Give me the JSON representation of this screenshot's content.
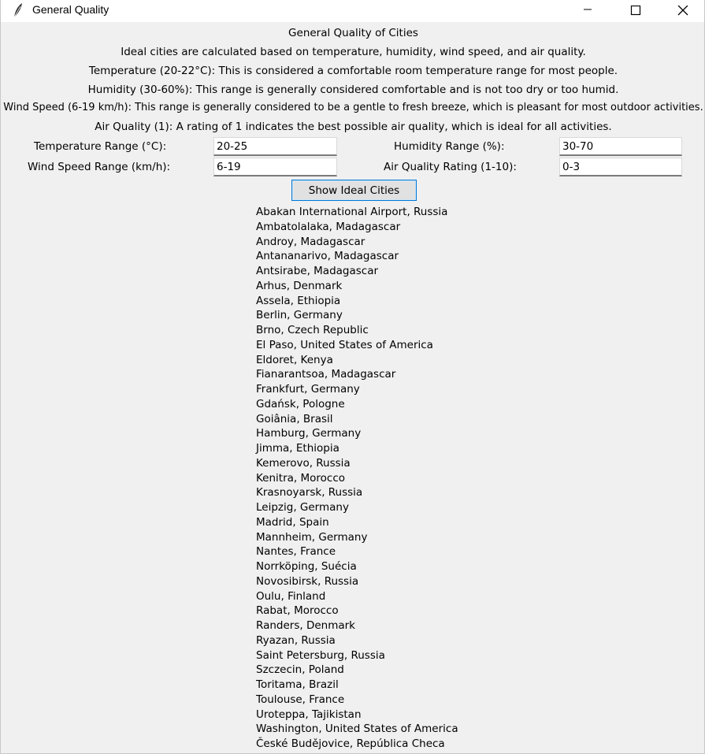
{
  "window": {
    "title": "General Quality",
    "icon": "feather-icon",
    "buttons": [
      "minimize-icon",
      "maximize-icon",
      "close-icon"
    ]
  },
  "header": {
    "heading": "General Quality of Cities",
    "lines": [
      "Ideal cities are calculated based on temperature, humidity, wind speed, and air quality.",
      "Temperature (20-22°C): This is considered a comfortable room temperature range for most people.",
      "Humidity (30-60%): This range is generally considered comfortable and is not too dry or too humid.",
      "Wind Speed (6-19 km/h): This range is generally considered to be a gentle to fresh breeze, which is pleasant for most outdoor activities.",
      "Air Quality (1): A rating of 1 indicates the best possible air quality, which is ideal for all activities."
    ]
  },
  "form": {
    "temperature": {
      "label": "Temperature Range (°C):",
      "value": "20-25"
    },
    "humidity": {
      "label": "Humidity Range (%):",
      "value": "30-70"
    },
    "wind": {
      "label": "Wind Speed Range (km/h):",
      "value": "6-19"
    },
    "air": {
      "label": "Air Quality Rating (1-10):",
      "value": "0-3"
    },
    "button_label": "Show Ideal Cities"
  },
  "results": [
    "Abakan International Airport, Russia",
    "Ambatolalaka, Madagascar",
    "Androy, Madagascar",
    "Antananarivo, Madagascar",
    "Antsirabe, Madagascar",
    "Arhus, Denmark",
    "Assela, Ethiopia",
    "Berlin, Germany",
    "Brno, Czech Republic",
    "El Paso, United States of America",
    "Eldoret, Kenya",
    "Fianarantsoa, Madagascar",
    "Frankfurt, Germany",
    "Gdańsk, Pologne",
    "Goiânia, Brasil",
    "Hamburg, Germany",
    "Jimma, Ethiopia",
    "Kemerovo, Russia",
    "Kenitra, Morocco",
    "Krasnoyarsk, Russia",
    "Leipzig, Germany",
    "Madrid, Spain",
    "Mannheim, Germany",
    "Nantes, France",
    "Norrköping, Suécia",
    "Novosibirsk, Russia",
    "Oulu, Finland",
    "Rabat, Morocco",
    "Randers, Denmark",
    "Ryazan, Russia",
    "Saint Petersburg, Russia",
    "Szczecin, Poland",
    "Toritama, Brazil",
    "Toulouse, France",
    "Uroteppa, Tajikistan",
    "Washington, United States of America",
    "České Budějovice, República Checa"
  ]
}
